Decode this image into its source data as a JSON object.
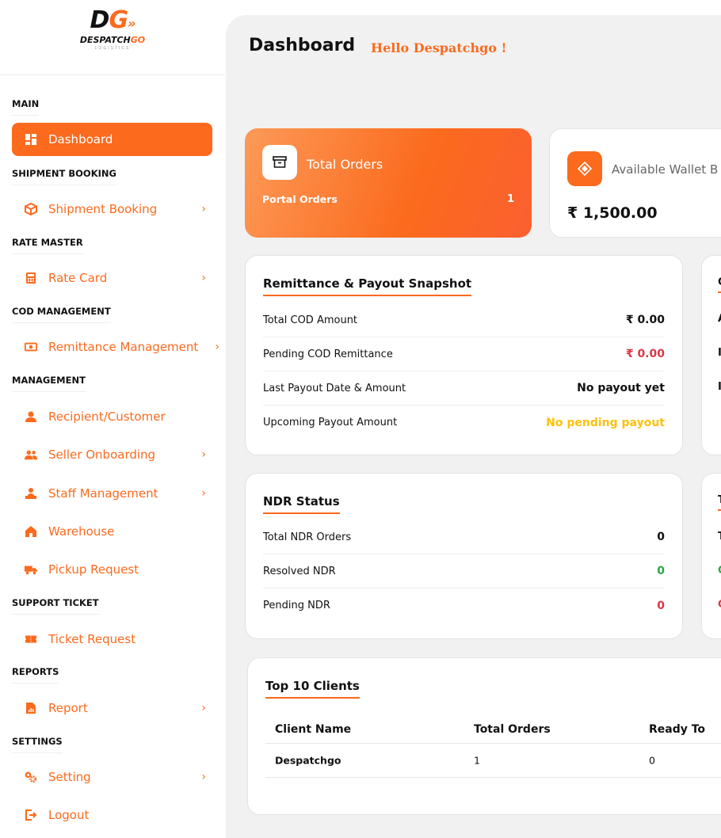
{
  "brand": {
    "logo_mark_prefix": "D",
    "logo_mark_suffix": "G",
    "logo_text_prefix": "DESPATCH",
    "logo_text_suffix": "GO",
    "logo_sub": "LOGISTICS"
  },
  "sidebar": {
    "sections": {
      "main": "MAIN",
      "shipment": "SHIPMENT BOOKING",
      "rate": "RATE MASTER",
      "cod": "COD MANAGEMENT",
      "management": "MANAGEMENT",
      "support": "SUPPORT TICKET",
      "reports": "REPORTS",
      "settings": "SETTINGS"
    },
    "items": {
      "dashboard": "Dashboard",
      "shipment_booking": "Shipment Booking",
      "rate_card": "Rate Card",
      "remittance": "Remittance Management",
      "recipient": "Recipient/Customer",
      "seller": "Seller Onboarding",
      "staff": "Staff Management",
      "warehouse": "Warehouse",
      "pickup": "Pickup Request",
      "ticket": "Ticket Request",
      "report": "Report",
      "setting": "Setting",
      "logout": "Logout"
    },
    "chevron": "›"
  },
  "header": {
    "title": "Dashboard",
    "greeting": "Hello Despatchgo !"
  },
  "stats": {
    "orders_label": "Total Orders",
    "portal_orders_label": "Portal Orders",
    "portal_orders_value": "1",
    "wallet_label": "Available Wallet B",
    "wallet_amount": "₹ 1,500.00"
  },
  "remittance": {
    "title": "Remittance & Payout Snapshot",
    "rows": [
      {
        "label": "Total COD Amount",
        "value": "₹ 0.00"
      },
      {
        "label": "Pending COD Remittance",
        "value": "₹ 0.00"
      },
      {
        "label": "Last Payout Date & Amount",
        "value": "No payout yet"
      },
      {
        "label": "Upcoming Payout Amount",
        "value": "No pending payout"
      }
    ]
  },
  "ndr": {
    "title": "NDR Status",
    "rows": [
      {
        "label": "Total NDR Orders",
        "value": "0"
      },
      {
        "label": "Resolved NDR",
        "value": "0"
      },
      {
        "label": "Pending NDR",
        "value": "0"
      }
    ]
  },
  "side_fragments": {
    "panel1": [
      "C",
      "A",
      "I",
      "I"
    ],
    "panel2": [
      "T",
      "T",
      "C",
      "C"
    ]
  },
  "clients": {
    "title": "Top 10 Clients",
    "columns": [
      "Client Name",
      "Total Orders",
      "Ready To"
    ],
    "rows": [
      [
        "Despatchgo",
        "1",
        "0"
      ]
    ]
  },
  "colors": {
    "accent": "#fb6a1d",
    "danger": "#dc3545",
    "success": "#28a745",
    "warning": "#ffc107"
  }
}
